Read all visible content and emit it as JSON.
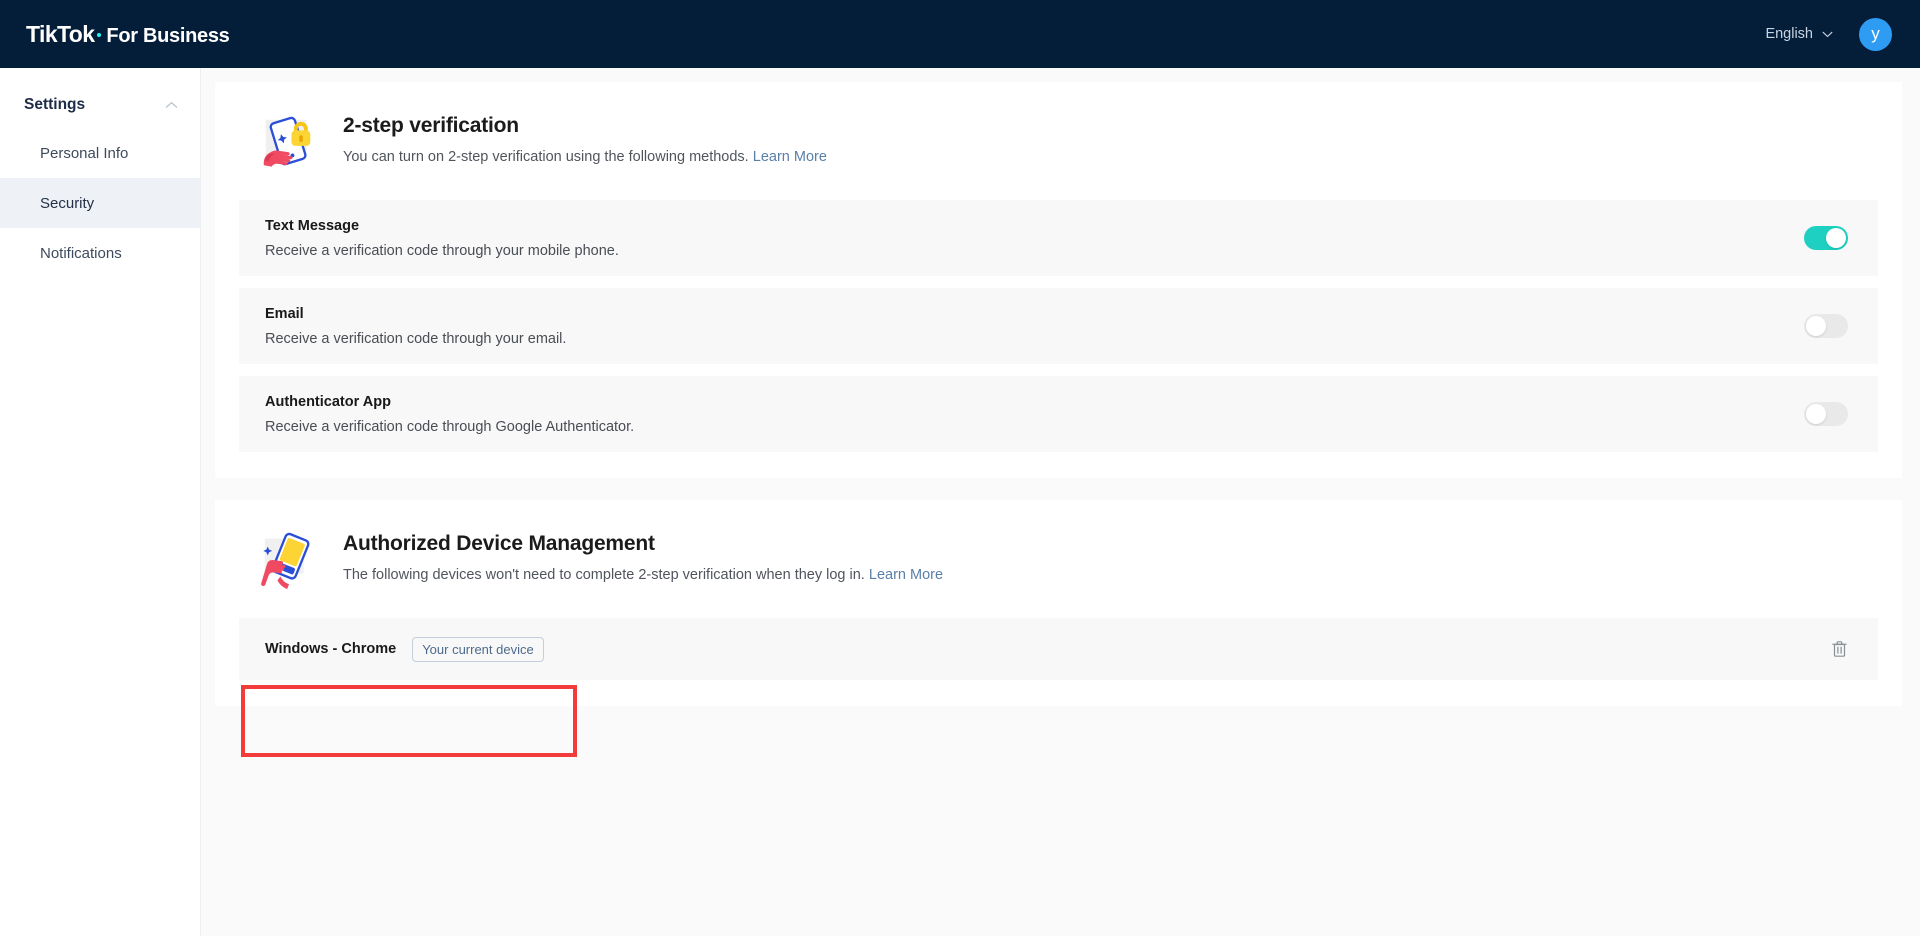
{
  "topbar": {
    "logo_primary": "TikTok",
    "logo_secondary": "For Business",
    "language_label": "English",
    "language_chevron_icon": "chevron-down-icon",
    "avatar_initial": "y",
    "avatar_color": "#2f9cf4",
    "background_color": "#041e3a"
  },
  "sidebar": {
    "header_label": "Settings",
    "header_chevron_icon": "chevron-up-icon",
    "items": [
      {
        "label": "Personal Info",
        "active": false
      },
      {
        "label": "Security",
        "active": true
      },
      {
        "label": "Notifications",
        "active": false
      }
    ]
  },
  "two_step": {
    "illustration_icon": "phone-lock-hand-illustration",
    "title": "2-step verification",
    "description": "You can turn on 2-step verification using the following methods.",
    "learn_more": "Learn More",
    "methods": [
      {
        "name": "Text Message",
        "description": "Receive a verification code through your mobile phone.",
        "enabled": true,
        "toggle_icon": "toggle-on-icon"
      },
      {
        "name": "Email",
        "description": "Receive a verification code through your email.",
        "enabled": false,
        "toggle_icon": "toggle-off-icon"
      },
      {
        "name": "Authenticator App",
        "description": "Receive a verification code through Google Authenticator.",
        "enabled": false,
        "toggle_icon": "toggle-off-icon"
      }
    ]
  },
  "devices": {
    "illustration_icon": "hand-holding-phone-illustration",
    "title": "Authorized Device Management",
    "description": "The following devices won't need to complete 2-step verification when they log in.",
    "learn_more": "Learn More",
    "rows": [
      {
        "name": "Windows - Chrome",
        "badge": "Your current device",
        "delete_icon": "trash-icon"
      }
    ]
  },
  "annotation": {
    "color": "#f23b3b",
    "target": "Windows - Chrome"
  },
  "colors": {
    "toggle_on": "#1ed0c1",
    "toggle_off": "#e9e9e9",
    "link": "#5a7fa8",
    "page_background": "#fafafa",
    "row_background": "#f8f8f8"
  }
}
